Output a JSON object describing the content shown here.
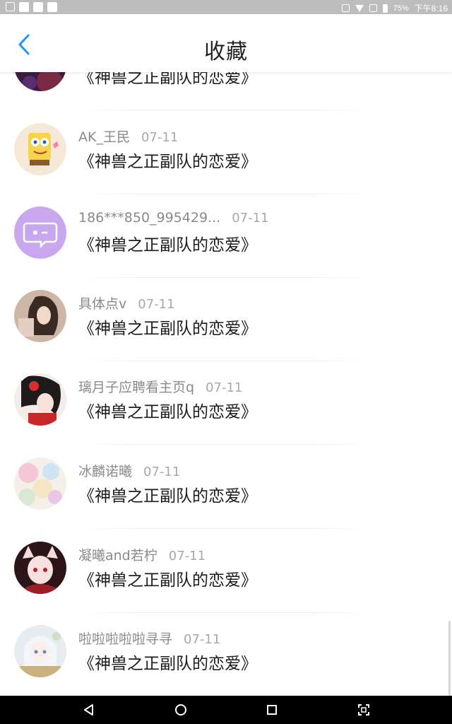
{
  "status_bar": {
    "battery": "75%",
    "time": "下午8:16"
  },
  "header": {
    "title": "收藏"
  },
  "items": [
    {
      "user": "",
      "date": "",
      "text": "《神兽之正副队的恋爱》",
      "avatar": "dark-purple"
    },
    {
      "user": "AK_王民",
      "date": "07-11",
      "text": "《神兽之正副队的恋爱》",
      "avatar": "spongebob"
    },
    {
      "user": "186***850_995429...",
      "date": "07-11",
      "text": "《神兽之正副队的恋爱》",
      "avatar": "default-chat"
    },
    {
      "user": "具体点v",
      "date": "07-11",
      "text": "《神兽之正副队的恋爱》",
      "avatar": "photo-girl"
    },
    {
      "user": "璃月子应聘看主页q",
      "date": "07-11",
      "text": "《神兽之正副队的恋爱》",
      "avatar": "red-flower-girl"
    },
    {
      "user": "冰麟诺曦",
      "date": "07-11",
      "text": "《神兽之正副队的恋爱》",
      "avatar": "anime-pastel"
    },
    {
      "user": "凝曦and若柠",
      "date": "07-11",
      "text": "《神兽之正副队的恋爱》",
      "avatar": "anime-fox"
    },
    {
      "user": "啦啦啦啦啦寻寻",
      "date": "07-11",
      "text": "《神兽之正副队的恋爱》",
      "avatar": "anime-white-hair"
    }
  ],
  "colors": {
    "accent": "#2196f3",
    "default_avatar": "#c9a7ef"
  },
  "icons": {
    "back": "chevron-left-icon",
    "nav_back": "triangle-back-icon",
    "nav_home": "circle-home-icon",
    "nav_recents": "square-recents-icon",
    "nav_screenshot": "screenshot-icon"
  }
}
